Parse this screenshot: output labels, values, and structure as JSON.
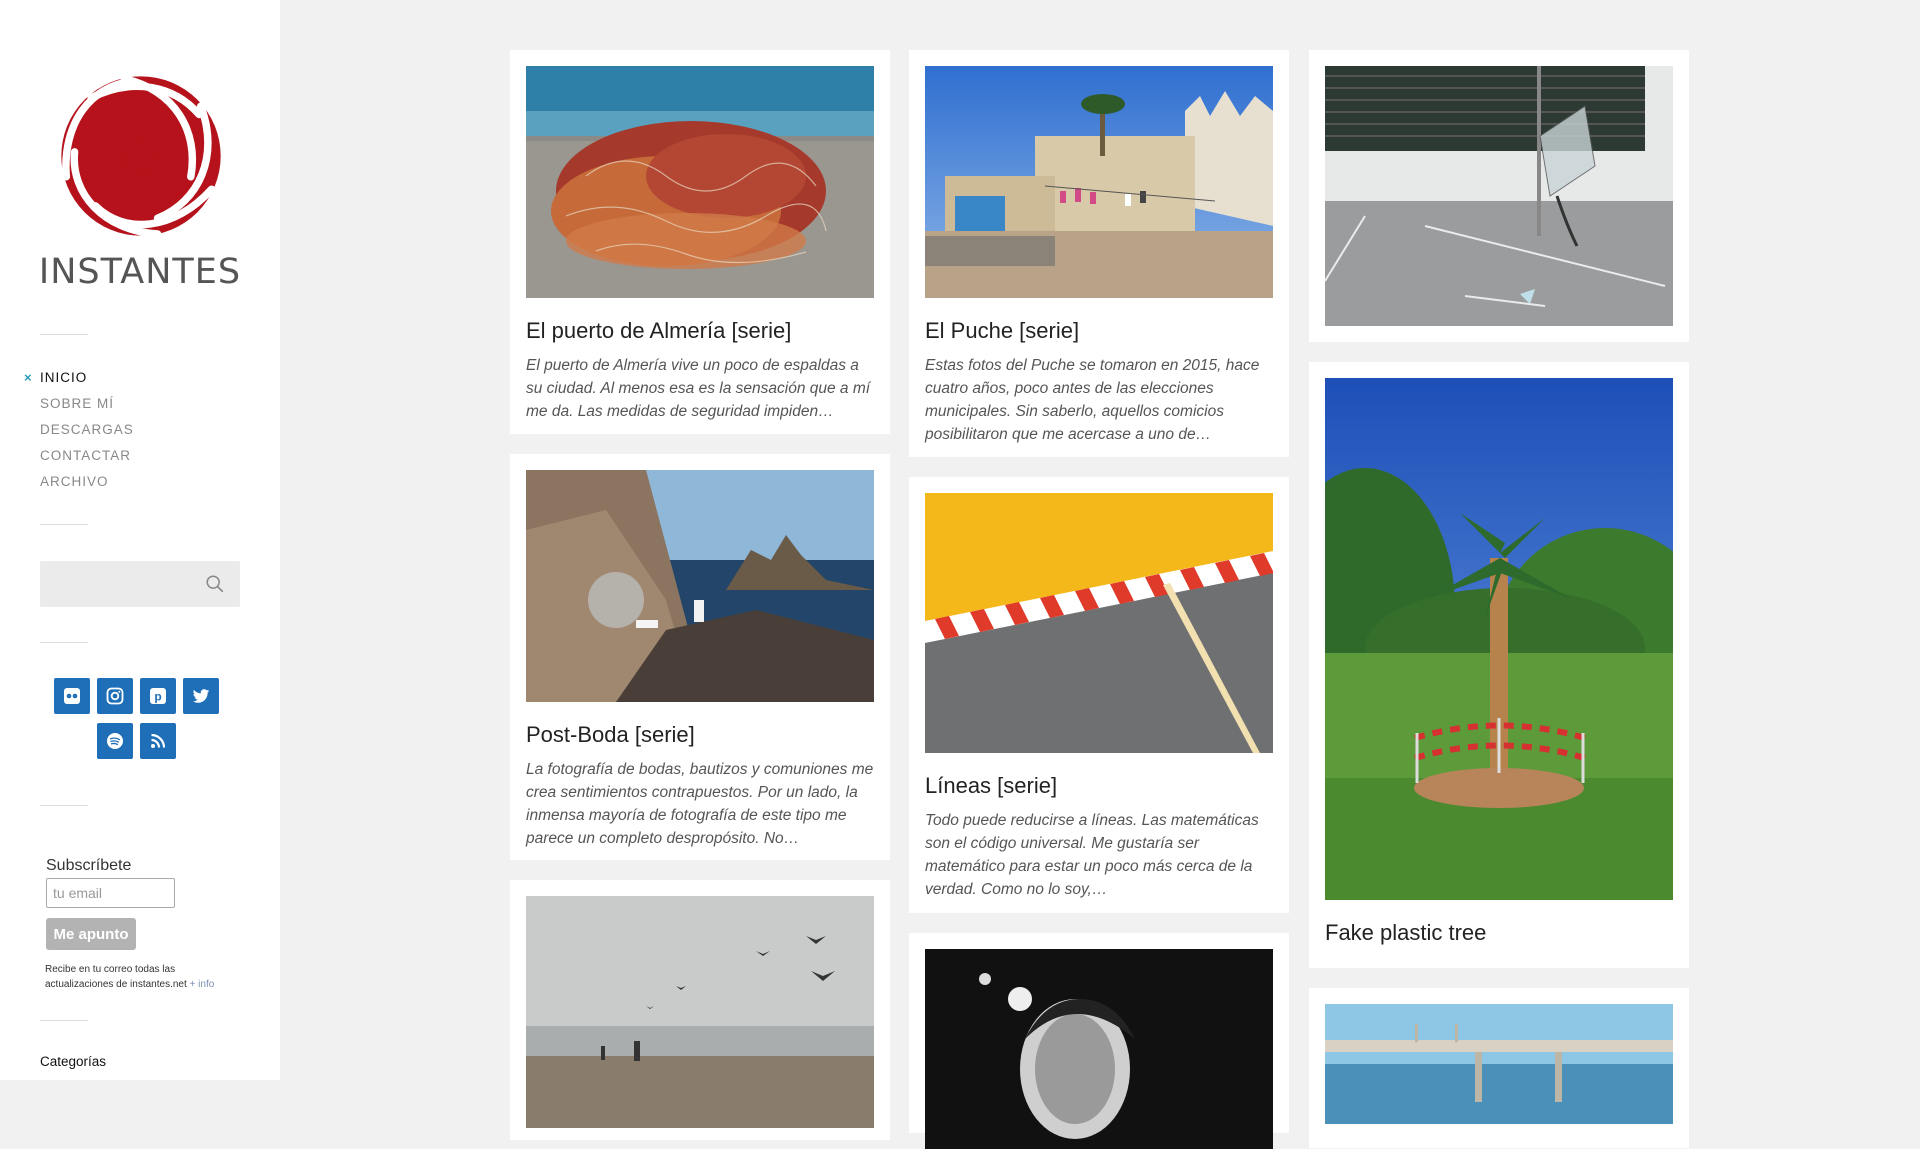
{
  "site": {
    "title": "INSTANTES"
  },
  "nav": {
    "active_mark": "×",
    "items": [
      "INICIO",
      "SOBRE MÍ",
      "DESCARGAS",
      "CONTACTAR",
      "ARCHIVO"
    ]
  },
  "search": {
    "placeholder": ""
  },
  "social": [
    "flickr-icon",
    "instagram-icon",
    "pinterest-icon",
    "twitter-icon",
    "spotify-icon",
    "rss-icon"
  ],
  "colors": {
    "accent": "#2a9bb8",
    "brand_red": "#b5121b",
    "social_bg": "#1e6fb8"
  },
  "subscribe": {
    "title": "Subscríbete",
    "placeholder": "tu email",
    "button": "Me apunto",
    "note": "Recibe en tu correo todas las actualizaciones de instantes.net",
    "more": "+ info"
  },
  "categories": {
    "title": "Categorías"
  },
  "posts": [
    {
      "title": "El puerto de Almería [serie]",
      "excerpt": "El puerto de Almería vive un poco de espaldas a su ciudad. Al menos esa es la sensación que a mí me da. Las medidas de seguridad impiden…"
    },
    {
      "title": "Post-Boda [serie]",
      "excerpt": "La fotografía de bodas, bautizos y comuniones me crea sentimientos contrapuestos. Por un lado,  la inmensa mayoría de fotografía de este tipo me parece un completo despropósito. No…"
    },
    {
      "title": "El Puche [serie]",
      "excerpt": "Estas fotos del Puche se tomaron en 2015, hace cuatro años, poco antes de las elecciones municipales. Sin saberlo, aquellos comicios posibilitaron que me acercase a uno de…"
    },
    {
      "title": "Líneas [serie]",
      "excerpt": "Todo puede reducirse a líneas. Las matemáticas son el código universal. Me gustaría ser matemático para estar un poco más cerca de la verdad. Como no lo soy,…"
    },
    {
      "title": "Fake plastic tree",
      "excerpt": ""
    }
  ]
}
